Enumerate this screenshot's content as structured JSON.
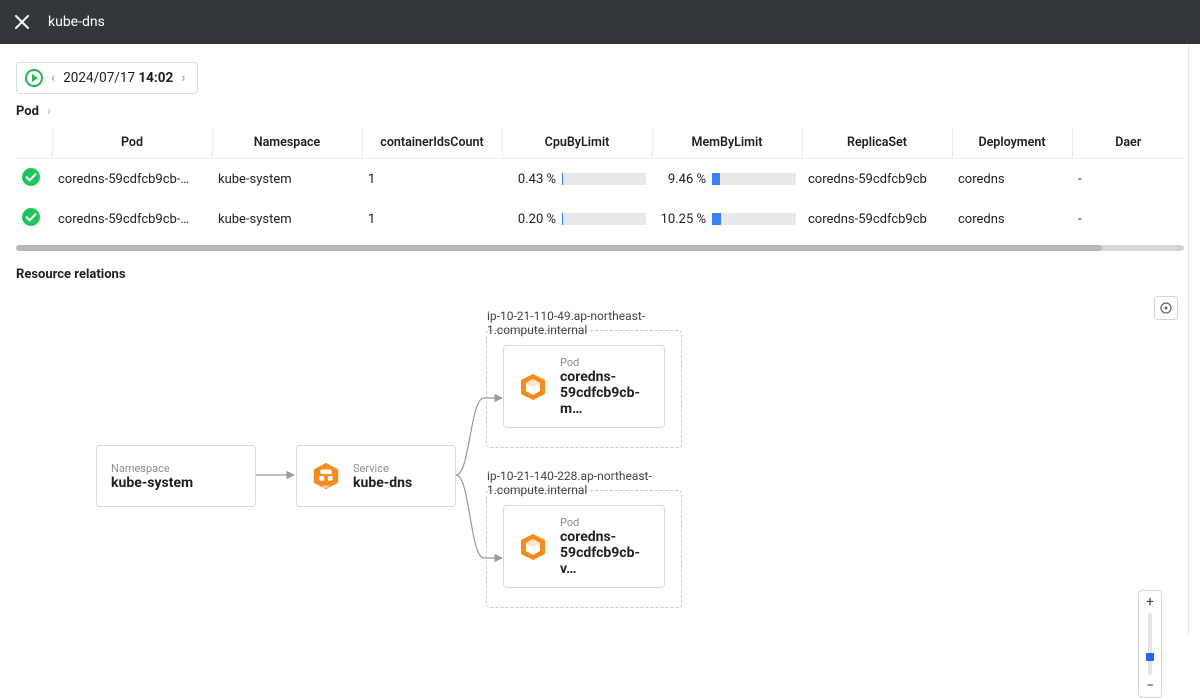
{
  "header": {
    "title": "kube-dns"
  },
  "timepicker": {
    "date": "2024/07/17",
    "time": "14:02"
  },
  "breadcrumb": {
    "root": "Pod"
  },
  "table": {
    "columns": [
      "Pod",
      "Namespace",
      "containerIdsCount",
      "CpuByLimit",
      "MemByLimit",
      "ReplicaSet",
      "Deployment",
      "Daer"
    ],
    "rows": [
      {
        "pod": "coredns-59cdfcb9cb-…",
        "namespace": "kube-system",
        "containers": "1",
        "cpu": "0.43 %",
        "cpu_pct": 0.43,
        "mem": "9.46 %",
        "mem_pct": 9.46,
        "rs": "coredns-59cdfcb9cb",
        "dep": "coredns",
        "daer": "-"
      },
      {
        "pod": "coredns-59cdfcb9cb-…",
        "namespace": "kube-system",
        "containers": "1",
        "cpu": "0.20 %",
        "cpu_pct": 0.2,
        "mem": "10.25 %",
        "mem_pct": 10.25,
        "rs": "coredns-59cdfcb9cb",
        "dep": "coredns",
        "daer": "-"
      }
    ]
  },
  "relations": {
    "title": "Resource relations",
    "namespace": {
      "kind": "Namespace",
      "name": "kube-system"
    },
    "service": {
      "kind": "Service",
      "name": "kube-dns"
    },
    "groups": [
      {
        "label": "ip-10-21-110-49.ap-northeast-1.compute.internal",
        "pod": {
          "kind": "Pod",
          "name": "coredns-59cdfcb9cb-m…"
        }
      },
      {
        "label": "ip-10-21-140-228.ap-northeast-1.compute.internal",
        "pod": {
          "kind": "Pod",
          "name": "coredns-59cdfcb9cb-v…"
        }
      }
    ]
  },
  "colors": {
    "accent": "#f68c1e",
    "success": "#22c55e",
    "bar": "#3b82f6"
  }
}
